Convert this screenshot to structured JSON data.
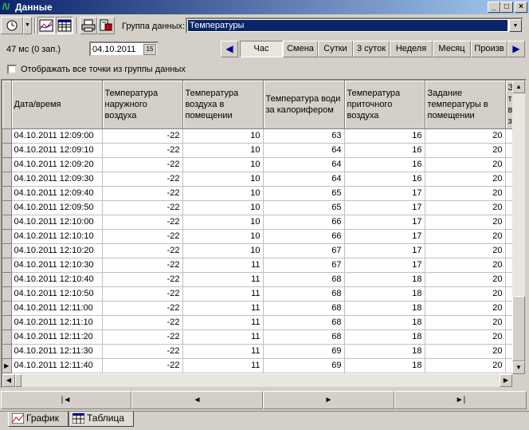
{
  "window": {
    "title": "Данные",
    "app_icon": "chart-app-icon"
  },
  "toolbar": {
    "group_label": "Группа данных:",
    "group_value": "Температуры"
  },
  "status": {
    "timing": "47 мс (0 зап.)",
    "date": "04.10.2011"
  },
  "periods": [
    "Час",
    "Смена",
    "Сутки",
    "3 суток",
    "Неделя",
    "Месяц",
    "Произв"
  ],
  "active_period": "Час",
  "checkbox": {
    "label": "Отображать все точки из группы данных",
    "checked": false
  },
  "table": {
    "headers": [
      "Дата/время",
      "Температура наружного воздуха",
      "Температура воздуха в помещении",
      "Температура води за калорифером",
      "Температура приточного воздуха",
      "Задание температуры в помещении",
      "За те во за"
    ],
    "rows": [
      [
        "04.10.2011 12:09:00",
        "-22",
        "10",
        "63",
        "16",
        "20"
      ],
      [
        "04.10.2011 12:09:10",
        "-22",
        "10",
        "64",
        "16",
        "20"
      ],
      [
        "04.10.2011 12:09:20",
        "-22",
        "10",
        "64",
        "16",
        "20"
      ],
      [
        "04.10.2011 12:09:30",
        "-22",
        "10",
        "64",
        "16",
        "20"
      ],
      [
        "04.10.2011 12:09:40",
        "-22",
        "10",
        "65",
        "17",
        "20"
      ],
      [
        "04.10.2011 12:09:50",
        "-22",
        "10",
        "65",
        "17",
        "20"
      ],
      [
        "04.10.2011 12:10:00",
        "-22",
        "10",
        "66",
        "17",
        "20"
      ],
      [
        "04.10.2011 12:10:10",
        "-22",
        "10",
        "66",
        "17",
        "20"
      ],
      [
        "04.10.2011 12:10:20",
        "-22",
        "10",
        "67",
        "17",
        "20"
      ],
      [
        "04.10.2011 12:10:30",
        "-22",
        "11",
        "67",
        "17",
        "20"
      ],
      [
        "04.10.2011 12:10:40",
        "-22",
        "11",
        "68",
        "18",
        "20"
      ],
      [
        "04.10.2011 12:10:50",
        "-22",
        "11",
        "68",
        "18",
        "20"
      ],
      [
        "04.10.2011 12:11:00",
        "-22",
        "11",
        "68",
        "18",
        "20"
      ],
      [
        "04.10.2011 12:11:10",
        "-22",
        "11",
        "68",
        "18",
        "20"
      ],
      [
        "04.10.2011 12:11:20",
        "-22",
        "11",
        "68",
        "18",
        "20"
      ],
      [
        "04.10.2011 12:11:30",
        "-22",
        "11",
        "69",
        "18",
        "20"
      ],
      [
        "04.10.2011 12:11:40",
        "-22",
        "11",
        "69",
        "18",
        "20"
      ]
    ],
    "current_row": 16
  },
  "navigation": {
    "first": "|◄",
    "prev": "◄",
    "next": "►",
    "last": "►|"
  },
  "tabs": [
    {
      "label": "График",
      "icon": "chart-icon",
      "active": true
    },
    {
      "label": "Таблица",
      "icon": "table-icon",
      "active": false
    }
  ],
  "colors": {
    "titlebar": "#0a246a",
    "face": "#d4d0c8",
    "selection": "#0a246a"
  }
}
